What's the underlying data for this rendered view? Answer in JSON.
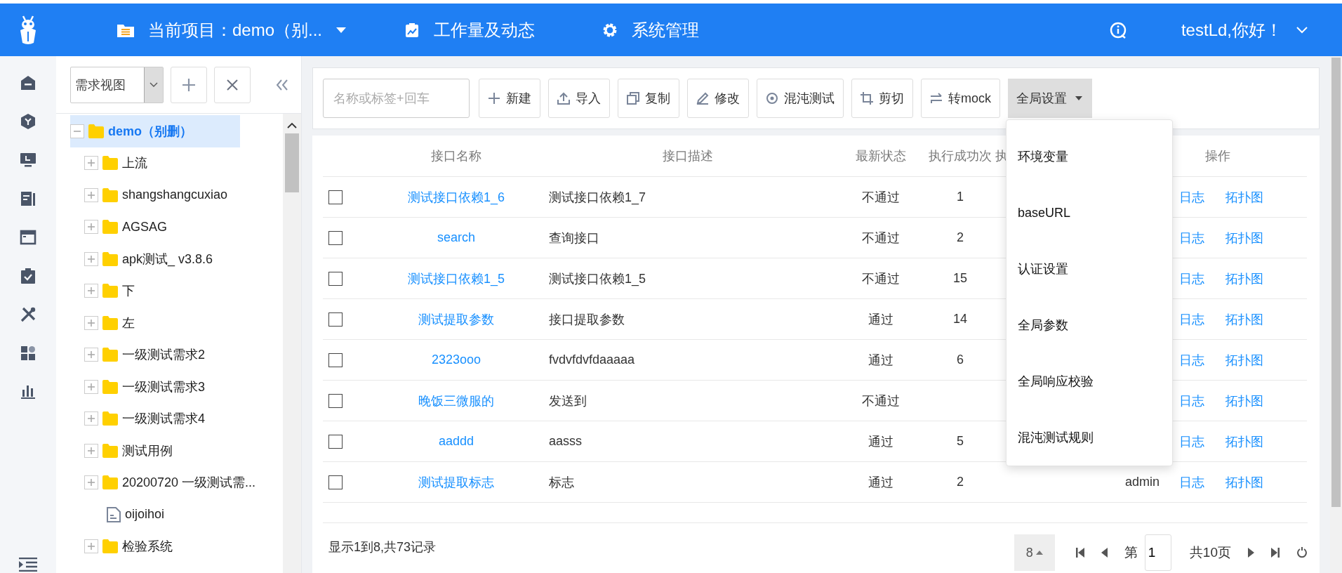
{
  "top_bar": {
    "project": "当前项目：demo（别...",
    "nav": [
      {
        "label": "工作量及动态",
        "kind": "chart"
      },
      {
        "label": "系统管理",
        "kind": "gear"
      }
    ],
    "user": "testLd,你好！"
  },
  "tree": {
    "view_select": "需求视图",
    "items": [
      {
        "label": "demo（别删）",
        "kind": "folder",
        "expanded": true,
        "selected": true,
        "children": [
          {
            "label": "上流",
            "kind": "folder",
            "expanded": false,
            "selected": false
          },
          {
            "label": "shangshangcuxiao",
            "kind": "folder",
            "expanded": false,
            "selected": false
          },
          {
            "label": "AGSAG",
            "kind": "folder",
            "expanded": false,
            "selected": false
          },
          {
            "label": "apk测试_ v3.8.6",
            "kind": "folder",
            "expanded": false,
            "selected": false
          },
          {
            "label": "下",
            "kind": "folder",
            "expanded": false,
            "selected": false
          },
          {
            "label": "左",
            "kind": "folder",
            "expanded": false,
            "selected": false
          },
          {
            "label": "一级测试需求2",
            "kind": "folder",
            "expanded": false,
            "selected": false
          },
          {
            "label": "一级测试需求3",
            "kind": "folder",
            "expanded": false,
            "selected": false
          },
          {
            "label": "一级测试需求4",
            "kind": "folder",
            "expanded": false,
            "selected": false
          },
          {
            "label": "测试用例",
            "kind": "folder",
            "expanded": false,
            "selected": false
          },
          {
            "label": "20200720 一级测试需...",
            "kind": "folder",
            "expanded": false,
            "selected": false
          },
          {
            "label": "oijoihoi",
            "kind": "file",
            "selected": false
          },
          {
            "label": "检验系统",
            "kind": "folder",
            "expanded": false,
            "selected": false
          }
        ]
      }
    ]
  },
  "toolbar": {
    "search": {
      "placeholder": "名称或标签+回车"
    },
    "buttons": [
      {
        "label": "新建",
        "kind": "add"
      },
      {
        "label": "导入",
        "kind": "import"
      },
      {
        "label": "复制",
        "kind": "copy"
      },
      {
        "label": "修改",
        "kind": "edit"
      },
      {
        "label": "混沌测试",
        "kind": "fuzz"
      },
      {
        "label": "剪切",
        "kind": "cut"
      },
      {
        "label": "转mock",
        "kind": "mock"
      }
    ],
    "settings_menu": {
      "label": "全局设置",
      "expanded": true,
      "items": [
        "环境变量",
        "baseURL",
        "认证设置",
        "全局参数",
        "全局响应校验",
        "混沌测试规则"
      ]
    }
  },
  "table": {
    "columns": [
      "接口名称",
      "接口描述",
      "最新状态",
      "执行成功次",
      "执",
      "操作"
    ],
    "rows": [
      {
        "checked": false,
        "name": "测试接口依赖1_6",
        "description": "测试接口依赖1_7",
        "status": "不通过",
        "success_count": "1",
        "actions": [
          "日志",
          "拓扑图"
        ]
      },
      {
        "checked": false,
        "name": "search",
        "description": "查询接口",
        "status": "不通过",
        "success_count": "2",
        "actions": [
          "日志",
          "拓扑图"
        ]
      },
      {
        "checked": false,
        "name": "测试接口依赖1_5",
        "description": "测试接口依赖1_5",
        "status": "不通过",
        "success_count": "15",
        "actions": [
          "日志",
          "拓扑图"
        ]
      },
      {
        "checked": false,
        "name": "测试提取参数",
        "description": "接口提取参数",
        "status": "通过",
        "success_count": "14",
        "actions": [
          "日志",
          "拓扑图"
        ]
      },
      {
        "checked": false,
        "name": "2323ooo",
        "description": "fvdvfdvfdaaaaa",
        "status": "通过",
        "success_count": "6",
        "actions": [
          "日志",
          "拓扑图"
        ]
      },
      {
        "checked": false,
        "name": "晚饭三微服的",
        "description": "发送到",
        "status": "不通过",
        "actions": [
          "日志",
          "拓扑图"
        ]
      },
      {
        "checked": false,
        "name": "aaddd",
        "description": "aasss",
        "status": "通过",
        "success_count": "5",
        "actions": [
          "日志",
          "拓扑图"
        ]
      },
      {
        "checked": false,
        "name": "测试提取标志",
        "description": "标志",
        "status": "通过",
        "success_count": "2",
        "column_6": "admin",
        "actions": [
          "日志",
          "拓扑图"
        ]
      }
    ]
  },
  "pager": {
    "summary": "显示1到8,共73记录",
    "page_size": "8",
    "page_label": "第",
    "page": "1",
    "total_pages": "共10页"
  }
}
